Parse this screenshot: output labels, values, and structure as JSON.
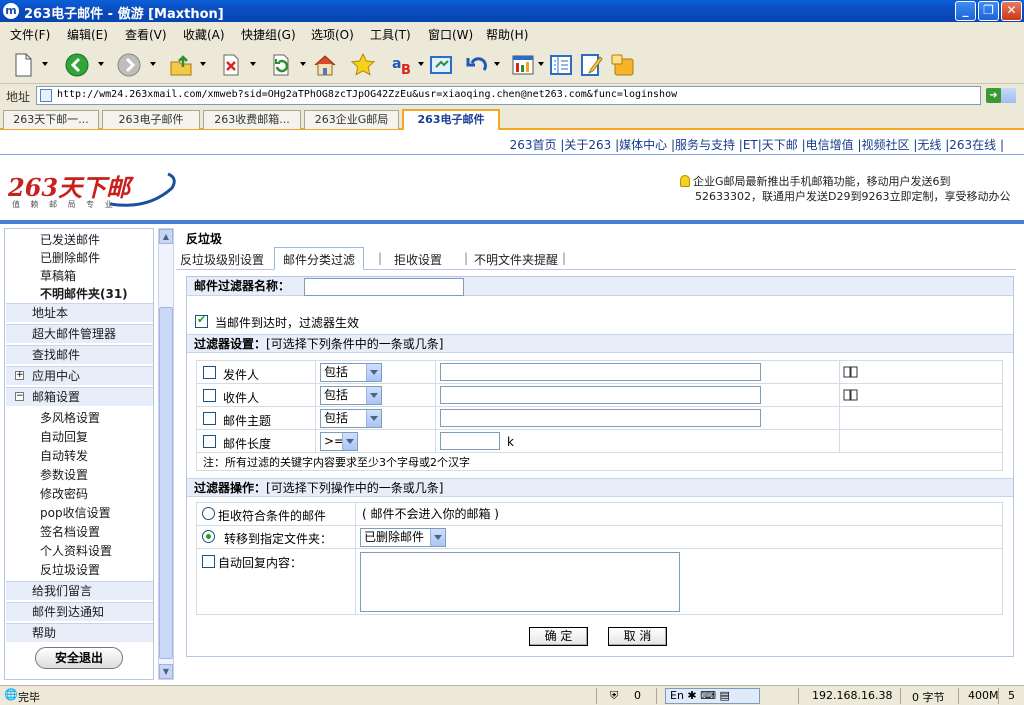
{
  "window": {
    "title": "263电子邮件 - 傲游 [Maxthon]",
    "app_icon": "m",
    "min_label": "_",
    "max_label": "❐",
    "close_label": "✕"
  },
  "menu": [
    "文件(F)",
    "编辑(E)",
    "查看(V)",
    "收藏(A)",
    "快捷组(G)",
    "选项(O)",
    "工具(T)",
    "窗口(W)",
    "帮助(H)"
  ],
  "address": {
    "label": "地址",
    "url": "http://wm24.263xmail.com/xmweb?sid=OHg2aTPhOG8zcTJpOG42ZzEu&usr=xiaoqing.chen@net263.com&func=loginshow"
  },
  "browser_tabs": [
    "263天下邮一...",
    "263电子邮件",
    "263收费邮箱...",
    "263企业G邮局",
    "263电子邮件"
  ],
  "top_links": "263首页 |关于263 |媒体中心 |服务与支持 |ET|天下邮 |电信增值 |视频社区 |无线 |263在线 |",
  "logo": {
    "text": "263天下邮",
    "subtitle": "值 赖 邮 局 专 业"
  },
  "notice": {
    "line1": "企业G邮局最新推出手机邮箱功能，移动用户发送6到",
    "line2": "52633302，联通用户发送D29到9263立即定制，享受移动办公"
  },
  "sidebar": {
    "sub_top": [
      "已发送邮件",
      "已删除邮件",
      "草稿箱",
      "不明邮件夹(31)"
    ],
    "main_items": [
      "地址本",
      "超大邮件管理器",
      "查找邮件",
      "应用中心",
      "邮箱设置"
    ],
    "settings_items": [
      "多风格设置",
      "自动回复",
      "自动转发",
      "参数设置",
      "修改密码",
      "pop收信设置",
      "签名档设置",
      "个人资料设置",
      "反垃圾设置"
    ],
    "bottom_items": [
      "给我们留言",
      "邮件到达通知",
      "帮助"
    ],
    "plus_symbol": "+",
    "minus_symbol": "−",
    "logout": "安全退出"
  },
  "content": {
    "title": "反垃圾",
    "tabs": [
      "反垃圾级别设置",
      "邮件分类过滤",
      "拒收设置",
      "不明文件夹提醒"
    ],
    "tab_sep": "|",
    "filter_name_label": "邮件过滤器名称：",
    "filter_name_value": "",
    "enable_label": "当邮件到达时，过滤器生效",
    "conditions_head": "过滤器设置：",
    "conditions_hint": "[可选择下列条件中的一条或几条]",
    "conditions": [
      {
        "label": "发件人",
        "op": "包括",
        "value": ""
      },
      {
        "label": "收件人",
        "op": "包括",
        "value": ""
      },
      {
        "label": "邮件主题",
        "op": "包括",
        "value": ""
      },
      {
        "label": "邮件长度",
        "op": ">=",
        "value": "",
        "unit": "k"
      }
    ],
    "note": "注：所有过滤的关键字内容要求至少3个字母或2个汉字",
    "actions_head": "过滤器操作：",
    "actions_hint": "[可选择下列操作中的一条或几条]",
    "action_reject": "拒收符合条件的邮件",
    "action_reject_note": "( 邮件不会进入你的邮箱 )",
    "action_move": "转移到指定文件夹：",
    "move_folder": "已删除邮件",
    "action_autoreply": "自动回复内容：",
    "autoreply_value": "",
    "ok": "确 定",
    "cancel": "取 消"
  },
  "status": {
    "text": "完毕",
    "count1": "0",
    "ime": "En",
    "ip": "192.168.16.38",
    "bytes": "0 字节",
    "mem": "400M",
    "num": "5"
  }
}
